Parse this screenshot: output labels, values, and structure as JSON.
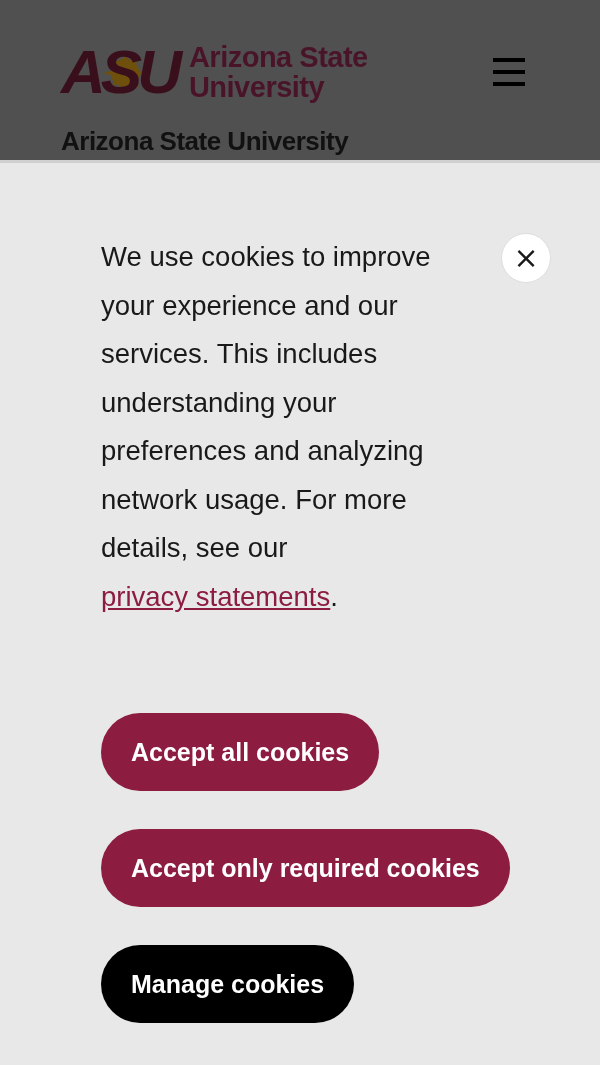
{
  "header": {
    "logo_mark": "ASU",
    "logo_text_line_1": "Arizona State",
    "logo_text_line_2": "University",
    "page_title": "Arizona State University"
  },
  "cookie_banner": {
    "message_before_link": "We use cookies to improve your experience and our services. This includes understanding your preferences and analyzing network usage. For more details, see our ",
    "link": "privacy statements",
    "message_after_link": ".",
    "close_label": "×",
    "buttons": [
      {
        "label": "Accept all cookies",
        "kind": "primary"
      },
      {
        "label": "Accept only required cookies",
        "kind": "primary"
      },
      {
        "label": "Manage cookies",
        "kind": "secondary"
      }
    ]
  }
}
